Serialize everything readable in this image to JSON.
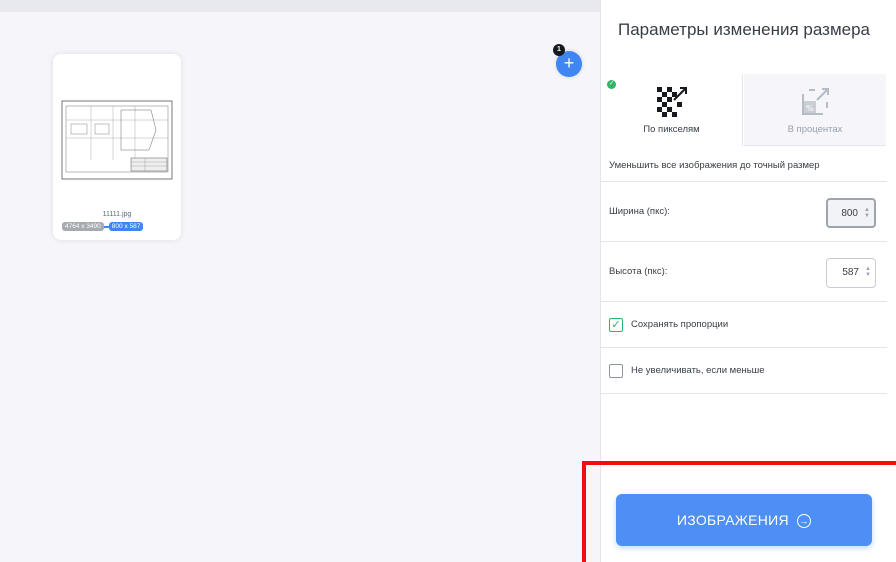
{
  "workspace": {
    "add_button_icon": "plus-icon",
    "file_count": "1",
    "file": {
      "name": "11111.jpg",
      "original_size": "4764 x 3490",
      "new_size": "800 x 587"
    }
  },
  "sidebar": {
    "title": "Параметры изменения размера",
    "tabs": [
      {
        "label": "По пикселям",
        "icon": "pixels-icon",
        "active": true
      },
      {
        "label": "В процентах",
        "icon": "percent-icon",
        "active": false
      }
    ],
    "description": "Уменьшить все изображения до точный размер",
    "width_label": "Ширина (пкс):",
    "width_value": "800",
    "height_label": "Высота (пкс):",
    "height_value": "587",
    "keep_ratio_label": "Сохранять пропорции",
    "keep_ratio_checked": true,
    "no_enlarge_label": "Не увеличивать, если меньше",
    "no_enlarge_checked": false,
    "submit_label": "ИЗОБРАЖЕНИЯ",
    "submit_icon": "arrow-right-circle-icon"
  },
  "colors": {
    "accent": "#4d8ff4",
    "success": "#30b566",
    "highlight": "#ee0f0f"
  }
}
